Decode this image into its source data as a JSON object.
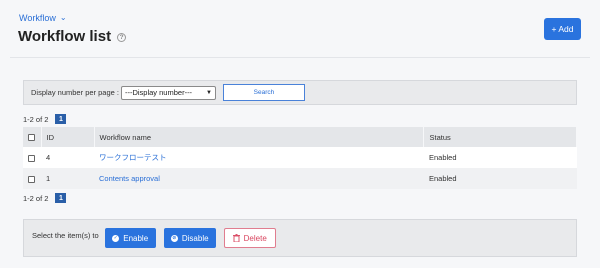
{
  "breadcrumb": {
    "label": "Workflow"
  },
  "page": {
    "title": "Workflow list"
  },
  "header": {
    "add_label": "+ Add"
  },
  "search": {
    "label": "Display number per page :",
    "select_value": "---Display number---",
    "button_label": "Search"
  },
  "pager_top": {
    "range": "1-2 of 2",
    "current_page": "1"
  },
  "table": {
    "headers": {
      "id": "ID",
      "name": "Workflow name",
      "status": "Status"
    },
    "rows": [
      {
        "id": "4",
        "name": "ワークフローテスト",
        "status": "Enabled"
      },
      {
        "id": "1",
        "name": "Contents approval",
        "status": "Enabled"
      }
    ]
  },
  "pager_bottom": {
    "range": "1-2 of 2",
    "current_page": "1"
  },
  "actions": {
    "label": "Select the item(s) to",
    "enable_label": "Enable",
    "disable_label": "Disable",
    "delete_label": "Delete"
  },
  "colors": {
    "primary": "#2a73de",
    "danger": "#d9455f",
    "link": "#2a6fd6"
  }
}
